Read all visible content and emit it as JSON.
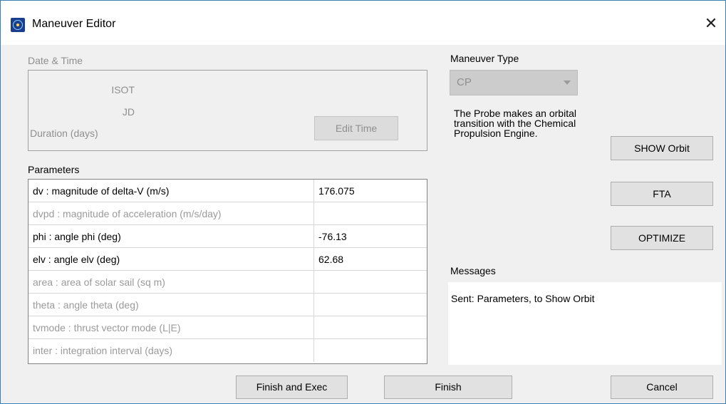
{
  "window": {
    "title": "Maneuver Editor",
    "close_glyph": "✕",
    "icon": "app-orbit-icon"
  },
  "datetime": {
    "group_label": "Date & Time",
    "isot_label": "ISOT",
    "jd_label": "JD",
    "duration_label": "Duration (days)",
    "edit_time_button": "Edit Time"
  },
  "maneuver_type": {
    "label": "Maneuver Type",
    "selected": "CP",
    "description": "The Probe makes an orbital transition with the Chemical Propulsion Engine."
  },
  "parameters": {
    "label": "Parameters",
    "rows": [
      {
        "name": "dv    : magnitude of delta-V (m/s)",
        "value": "176.075",
        "enabled": true
      },
      {
        "name": "dvpd : magnitude of acceleration (m/s/day)",
        "value": "",
        "enabled": false
      },
      {
        "name": "phi    : angle phi (deg)",
        "value": "-76.13",
        "enabled": true
      },
      {
        "name": "elv    : angle elv (deg)",
        "value": "62.68",
        "enabled": true
      },
      {
        "name": "area   : area of solar sail (sq m)",
        "value": "",
        "enabled": false
      },
      {
        "name": "theta : angle theta (deg)",
        "value": "",
        "enabled": false
      },
      {
        "name": "tvmode : thrust vector mode (L|E)",
        "value": "",
        "enabled": false
      },
      {
        "name": "inter : integration interval (days)",
        "value": "",
        "enabled": false
      }
    ]
  },
  "side_buttons": {
    "show_orbit": "SHOW Orbit",
    "fta": "FTA",
    "optimize": "OPTIMIZE"
  },
  "messages": {
    "label": "Messages",
    "text": "Sent: Parameters, to Show Orbit"
  },
  "footer": {
    "finish_exec": "Finish and Exec",
    "finish": "Finish",
    "cancel": "Cancel"
  },
  "colors": {
    "window_border": "#3c7fb1",
    "background": "#f0f0f0",
    "disabled_text": "#8f8f8f"
  }
}
